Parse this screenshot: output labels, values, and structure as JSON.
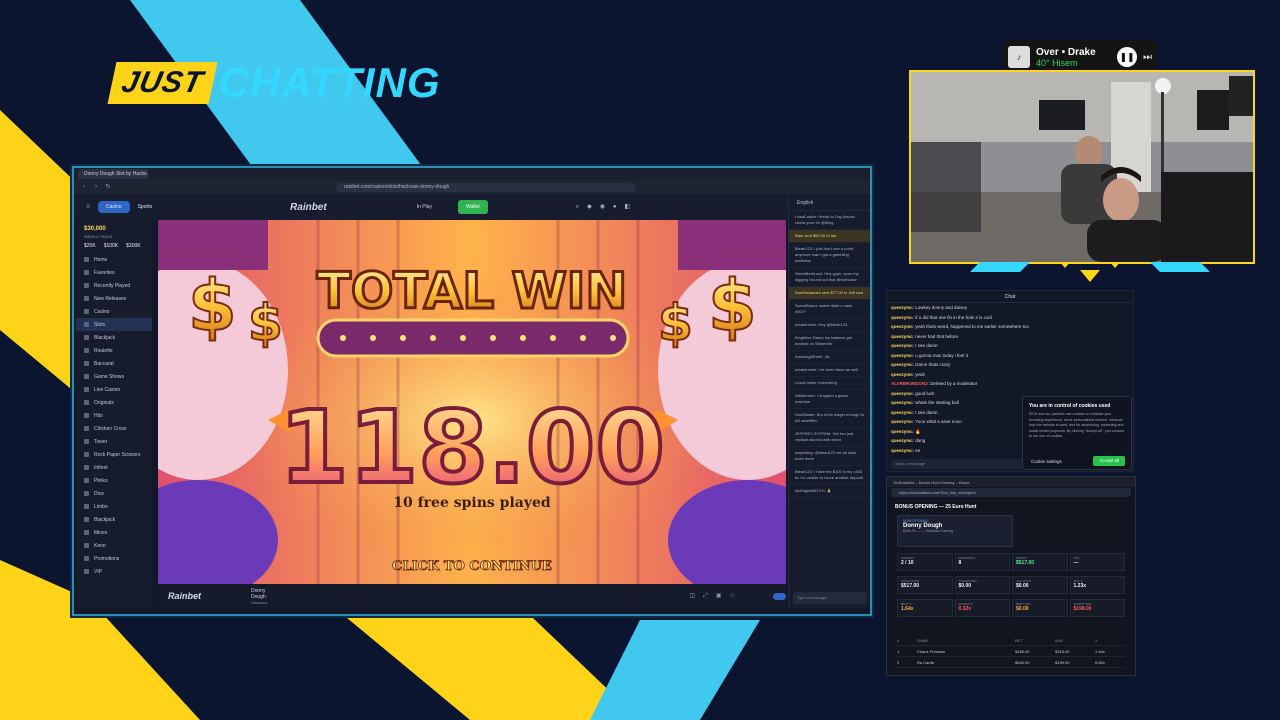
{
  "overlay": {
    "title_left": "JUST",
    "title_right": "CHATTING"
  },
  "spotify": {
    "track": "Over • Drake",
    "device": "40° Hisem",
    "pause_glyph": "❚❚",
    "next_glyph": "⏭"
  },
  "browser": {
    "tab_title": "Donny Dough Slot by Hacks...",
    "url": "rainbet.com/casino/slots/hacksaw-donny-dough",
    "header": {
      "casino": "Casino",
      "sports": "Sports",
      "logo": "Rainbet",
      "in_play": "In Play",
      "wallet": "Wallet"
    },
    "sidebar": {
      "balance": "$30,000",
      "balance_sub": "WEEKLY RACE",
      "stats": [
        "$25K",
        "$100K",
        "$300K"
      ],
      "items": [
        "Home",
        "Favorites",
        "Recently Played",
        "New Releases",
        "Casino",
        "Slots",
        "Blackjack",
        "Roulette",
        "Baccarat",
        "Game Shows",
        "Live Casino",
        "Originals",
        "Hilo",
        "Chicken Cross",
        "Tower",
        "Rock Paper Scissors",
        "Infinet",
        "Plinko",
        "Dice",
        "Limbo",
        "Blackjack",
        "Mines",
        "Keno",
        "Promotions",
        "VIP"
      ]
    },
    "game": {
      "banner": "TOTAL WIN",
      "amount": "118.00",
      "spins": "10 free spins played",
      "cta": "CLICK TO CONTINUE",
      "footer_logo": "Rainbet",
      "footer_title": "Donny Dough",
      "footer_sub": "Hacksaw"
    },
    "chat": {
      "language": "English",
      "messages": [
        "LosaCookin: Hread to Org Across check your fn! @tiling",
        "Rain sent $50.00 to tab",
        "Bleari123: I just don't see a point anymore man i got a gambling addiction",
        "StreetBestLuck: Hey guys, upon my digging i found out that @bothcase",
        "DuelNickames sent $77.00 to Jeff cool",
        "SweetBoard: sweet didnt u cash 400??",
        "urbanfunnel: Hey @bleari123",
        "KingMan: Damn my balance got drained on SteamVer",
        "AmazingWheel: .dk",
        "urbanfunnel: I've been there as well",
        "LosaCookin: interesting",
        "NibbleUser: i dropped a game machine",
        "DeeMaster: Bro uhhh wager enough to kill unseffkin",
        "JEFFREY-SYSTEM: Yeh bro just replace alcohol with weed",
        "icepicking: @bleari123 we all have been there",
        "Bleari123: I have the $100 in my c400 bc I'm unable to move another deposit",
        "McEagleMATCH: 🙏"
      ],
      "input_placeholder": "Type a message..."
    }
  },
  "stream_chat": {
    "header": "Chat",
    "lines": [
      {
        "user": "queezymc",
        "text": "Lowkey donny and daisey",
        "color": "yellow"
      },
      {
        "user": "queezymc",
        "text": "if u did that one fin in the hole 2 is cool",
        "color": "yellow"
      },
      {
        "user": "queezymc",
        "text": "yeah thats weird, happened to me earlier somewhere too",
        "color": "yellow"
      },
      {
        "user": "queezymc",
        "text": "never had that before",
        "color": "yellow"
      },
      {
        "user": "queezymc",
        "text": "I see damn",
        "color": "yellow"
      },
      {
        "user": "queezymc",
        "text": "u gonna max today i feel it",
        "color": "yellow"
      },
      {
        "user": "queezymc",
        "text": "Damn thats crazy",
        "color": "yellow"
      },
      {
        "user": "queezymc",
        "text": "yeah",
        "color": "yellow"
      },
      {
        "user": "ALVRBR4NDON3",
        "text": "Deleted by a moderator",
        "color": "red"
      },
      {
        "user": "queezymc",
        "text": "good luck",
        "color": "yellow"
      },
      {
        "user": "queezymc",
        "text": "whats the starting ball",
        "color": "yellow"
      },
      {
        "user": "queezymc",
        "text": "I see damn",
        "color": "yellow"
      },
      {
        "user": "queezymc",
        "text": "Yooo what a save nooo",
        "color": "yellow"
      },
      {
        "user": "queezymc",
        "text": "🔥",
        "color": "yellow"
      },
      {
        "user": "queezymc",
        "text": "dang",
        "color": "yellow"
      },
      {
        "user": "queezymc",
        "text": "ee",
        "color": "yellow"
      }
    ],
    "send_placeholder": "Send a message",
    "cookie": {
      "title": "You are in control of cookies used",
      "body": "KICK and our partners use cookies to enhance your browsing experience, serve personalized content, measure how the website is used, and for advertising, marketing and social media purposes. By clicking \"Accept all\", you consent to our use of cookies.",
      "settings": "Cookie settings",
      "accept": "Accept all"
    }
  },
  "bonus_tracker": {
    "window_title": "SlotDataBot – Bonus Hunt Overlay – Brave",
    "url": "https://slotdatabot.com/Tool_link_overlay/v1",
    "title": "BONUS OPENING — 25 Euro Hunt",
    "card": {
      "label": "NOW OPENING",
      "game": "Donny Dough",
      "sub": "$180.00    —    —    Hacksaw Gaming"
    },
    "stats_row1": [
      {
        "k": "OPENED",
        "v": "2 / 10",
        "c": ""
      },
      {
        "k": "REMAINING",
        "v": "8",
        "c": ""
      },
      {
        "k": "PROFIT",
        "v": "$517.00",
        "c": "g"
      },
      {
        "k": "AVG",
        "v": "—",
        "c": ""
      }
    ],
    "stats_row2": [
      {
        "k": "TOTAL WINS",
        "v": "$517.00",
        "c": ""
      },
      {
        "k": "COLLECTED",
        "v": "$0.00",
        "c": ""
      },
      {
        "k": "AVG COST",
        "v": "$0.00",
        "c": ""
      },
      {
        "k": "AVG X",
        "v": "1.23x",
        "c": ""
      }
    ],
    "stats_row3": [
      {
        "k": "BEST X",
        "v": "1.64x",
        "c": "o"
      },
      {
        "k": "WORST X",
        "v": "0.32x",
        "c": "r"
      },
      {
        "k": "BEST WIN",
        "v": "$0.00",
        "c": "o"
      },
      {
        "k": "WORST WIN",
        "v": "$198.00",
        "c": "r"
      }
    ],
    "table_headers": [
      "#",
      "GAME",
      "BET",
      "WIN",
      "X"
    ],
    "rows": [
      [
        "1",
        "Chaos Princess",
        "$185.00",
        "$318.00",
        "1.64x"
      ],
      [
        "2",
        "Ra Cards",
        "$349.00",
        "$199.00",
        "0.62x"
      ]
    ]
  },
  "colors": {
    "yellow": "#ffd318",
    "cyan": "#34d8ff",
    "navy": "#0b1530"
  }
}
